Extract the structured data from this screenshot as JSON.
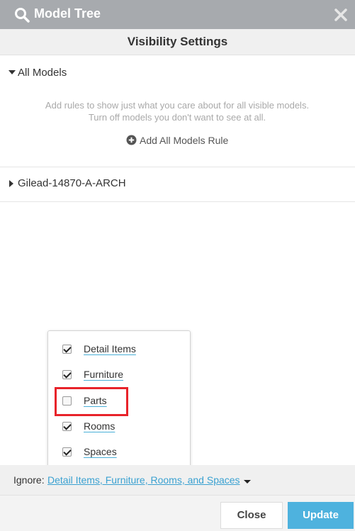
{
  "window": {
    "title": "Model Tree",
    "icon": "search-icon",
    "close_icon": "close-icon"
  },
  "panel": {
    "heading": "Visibility Settings"
  },
  "all_models": {
    "label": "All Models",
    "expanded": true,
    "help_text": "Add rules to show just what you care about for all visible models. Turn off models you don't want to see at all.",
    "add_rule_label": "Add All Models Rule",
    "add_rule_icon": "plus-circle-icon"
  },
  "model": {
    "label": "Gilead-14870-A-ARCH",
    "expanded": false
  },
  "ignore_dropdown": {
    "options": [
      {
        "label": "Detail Items",
        "checked": true
      },
      {
        "label": "Furniture",
        "checked": true
      },
      {
        "label": "Parts",
        "checked": false
      },
      {
        "label": "Rooms",
        "checked": true
      },
      {
        "label": "Spaces",
        "checked": true
      }
    ],
    "highlighted_option": "Parts"
  },
  "ignore": {
    "label": "Ignore:",
    "value": "Detail Items, Furniture, Rooms, and Spaces"
  },
  "footer": {
    "close_label": "Close",
    "update_label": "Update"
  },
  "colors": {
    "titlebar": "#a7aaae",
    "accent": "#4eb2de",
    "link": "#3aa1d1",
    "highlight_box": "#e8232a"
  }
}
